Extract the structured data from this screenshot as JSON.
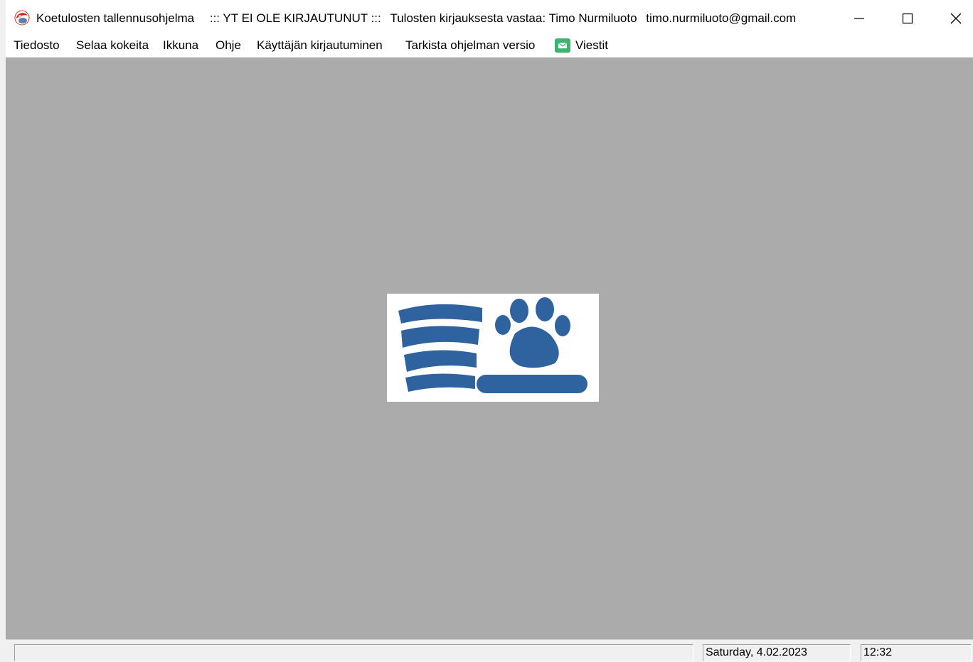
{
  "window": {
    "title_parts": [
      "Koetulosten tallennusohjelma",
      "::: YT EI OLE KIRJAUTUNUT :::",
      "Tulosten kirjauksesta vastaa: Timo Nurmiluoto",
      "timo.nurmiluoto@gmail.com"
    ],
    "icons": {
      "app": "app-logo-icon",
      "minimize": "minimize-icon",
      "maximize": "maximize-icon",
      "close": "close-icon"
    }
  },
  "menu": {
    "items": [
      "Tiedosto",
      "Selaa kokeita",
      "Ikkuna",
      "Ohje",
      "Käyttäjän kirjautuminen",
      "Tarkista ohjelman versio",
      "Viestit"
    ],
    "messages_icon": "envelope-icon"
  },
  "main": {
    "logo": "database-paw-logo"
  },
  "statusbar": {
    "main_text": "",
    "date": "Saturday,  4.02.2023",
    "time": "12:32"
  },
  "colors": {
    "client_background": "#ababab",
    "logo_blue": "#2f63a0",
    "message_green": "#3cb371"
  }
}
